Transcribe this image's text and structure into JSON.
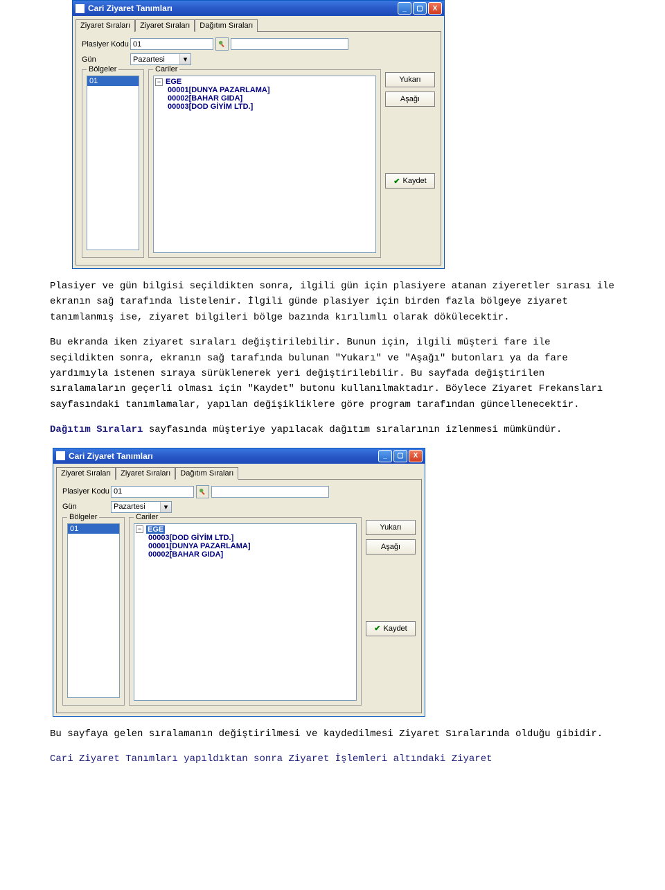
{
  "window1": {
    "title": "Cari Ziyaret Tanımları",
    "tabs": [
      "Ziyaret Sıraları",
      "Ziyaret Sıraları",
      "Dağıtım Sıraları"
    ],
    "active_tab": 1,
    "fields": {
      "plasiyer_label": "Plasiyer Kodu",
      "plasiyer_value": "01",
      "gun_label": "Gün",
      "gun_value": "Pazartesi"
    },
    "bolgeler": {
      "legend": "Bölgeler",
      "items": [
        "01"
      ]
    },
    "cariler": {
      "legend": "Cariler",
      "root": "EGE",
      "children": [
        "00001[DUNYA PAZARLAMA]",
        "00002[BAHAR GIDA]",
        "00003[DOD GİYİM LTD.]"
      ]
    },
    "buttons": {
      "up": "Yukarı",
      "down": "Aşağı",
      "save": "Kaydet"
    }
  },
  "paragraphs": {
    "p1": "Plasiyer ve gün bilgisi seçildikten sonra, ilgili gün için plasiyere atanan ziyeretler sırası ile ekranın sağ tarafında listelenir. İlgili günde plasiyer için birden fazla bölgeye ziyaret tanımlanmış ise, ziyaret bilgileri bölge bazında kırılımlı olarak dökülecektir.",
    "p2": "Bu ekranda iken ziyaret sıraları değiştirilebilir. Bunun için, ilgili müşteri fare ile seçildikten sonra, ekranın sağ tarafında bulunan \"Yukarı\" ve \"Aşağı\" butonları ya da fare yardımıyla istenen sıraya sürüklenerek yeri değiştirilebilir. Bu sayfada değiştirilen sıralamaların geçerli olması için \"Kaydet\" butonu kullanılmaktadır. Böylece Ziyaret Frekansları sayfasındaki tanımlamalar, yapılan değişikliklere göre program tarafından güncellenecektir.",
    "p3_hl": "Dağıtım Sıraları",
    "p3_rest": " sayfasında müşteriye yapılacak dağıtım sıralarının izlenmesi mümkündür.",
    "p4": "Bu sayfaya gelen sıralamanın değiştirilmesi ve kaydedilmesi Ziyaret Sıralarında olduğu gibidir.",
    "p5": "Cari Ziyaret Tanımları yapıldıktan sonra Ziyaret İşlemleri altındaki Ziyaret"
  },
  "window2": {
    "title": "Cari Ziyaret Tanımları",
    "tabs": [
      "Ziyaret Sıraları",
      "Ziyaret Sıraları",
      "Dağıtım Sıraları"
    ],
    "active_tab": 2,
    "fields": {
      "plasiyer_label": "Plasiyer Kodu",
      "plasiyer_value": "01",
      "gun_label": "Gün",
      "gun_value": "Pazartesi"
    },
    "bolgeler": {
      "legend": "Bölgeler",
      "items": [
        "01"
      ]
    },
    "cariler": {
      "legend": "Cariler",
      "root": "EGE",
      "children": [
        "00003[DOD GİYİM LTD.]",
        "00001[DUNYA PAZARLAMA]",
        "00002[BAHAR GIDA]"
      ]
    },
    "buttons": {
      "up": "Yukarı",
      "down": "Aşağı",
      "save": "Kaydet"
    }
  }
}
